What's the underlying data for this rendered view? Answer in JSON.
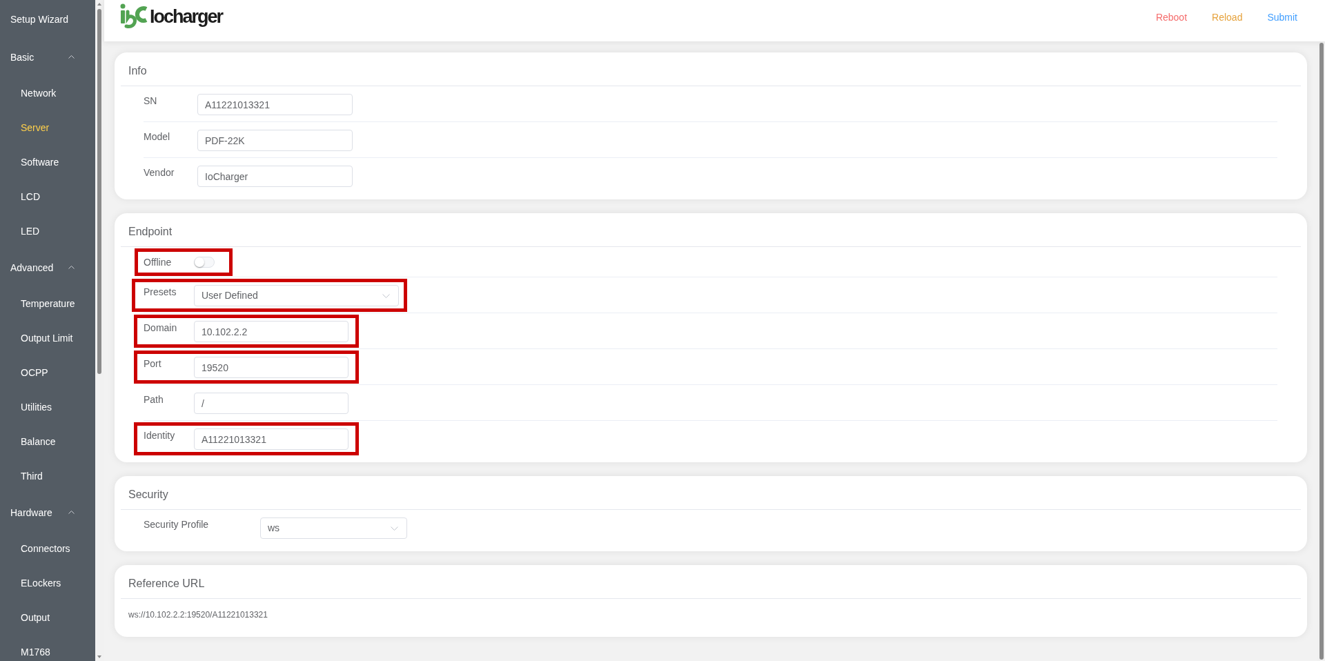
{
  "sidebar": {
    "items": [
      {
        "label": "Setup Wizard",
        "selected": false
      },
      {
        "label": "Basic",
        "selected": false,
        "expanded": true,
        "children": [
          {
            "label": "Network",
            "selected": false
          },
          {
            "label": "Server",
            "selected": true
          },
          {
            "label": "Software",
            "selected": false
          },
          {
            "label": "LCD",
            "selected": false
          },
          {
            "label": "LED",
            "selected": false
          }
        ]
      },
      {
        "label": "Advanced",
        "selected": false,
        "expanded": true,
        "children": [
          {
            "label": "Temperature",
            "selected": false
          },
          {
            "label": "Output Limit",
            "selected": false
          },
          {
            "label": "OCPP",
            "selected": false
          },
          {
            "label": "Utilities",
            "selected": false
          },
          {
            "label": "Balance",
            "selected": false
          },
          {
            "label": "Third",
            "selected": false
          }
        ]
      },
      {
        "label": "Hardware",
        "selected": false,
        "expanded": true,
        "children": [
          {
            "label": "Connectors",
            "selected": false
          },
          {
            "label": "ELockers",
            "selected": false
          },
          {
            "label": "Output",
            "selected": false
          },
          {
            "label": "M1768",
            "selected": false
          }
        ]
      }
    ]
  },
  "header": {
    "logo_text": "Iocharger",
    "actions": [
      {
        "label": "Reboot",
        "color": "#f56c6c"
      },
      {
        "label": "Reload",
        "color": "#e6a23c"
      },
      {
        "label": "Submit",
        "color": "#409eff"
      }
    ]
  },
  "sections": [
    {
      "kind": "form",
      "title": "Info",
      "fields": [
        {
          "kind": "input",
          "label": "SN",
          "value": "A11221013321"
        },
        {
          "kind": "input",
          "label": "Model",
          "value": "PDF-22K"
        },
        {
          "kind": "input",
          "label": "Vendor",
          "value": "IoCharger"
        }
      ]
    },
    {
      "kind": "form",
      "title": "Endpoint",
      "fields": [
        {
          "kind": "switch",
          "label": "Offline",
          "on": false,
          "highlighted": true
        },
        {
          "kind": "select",
          "label": "Presets",
          "value": "User Defined",
          "highlighted": true
        },
        {
          "kind": "input",
          "label": "Domain",
          "value": "10.102.2.2",
          "highlighted": true
        },
        {
          "kind": "input",
          "label": "Port",
          "value": "19520",
          "highlighted": true
        },
        {
          "kind": "input",
          "label": "Path",
          "value": "/",
          "highlighted": false
        },
        {
          "kind": "input",
          "label": "Identity",
          "value": "A11221013321",
          "highlighted": true
        }
      ]
    },
    {
      "kind": "form",
      "title": "Security",
      "fields": [
        {
          "kind": "select",
          "label": "Security Profile",
          "value": "ws"
        }
      ]
    },
    {
      "kind": "text",
      "title": "Reference URL",
      "text": "ws://10.102.2.2:19520/A11221013321"
    }
  ]
}
